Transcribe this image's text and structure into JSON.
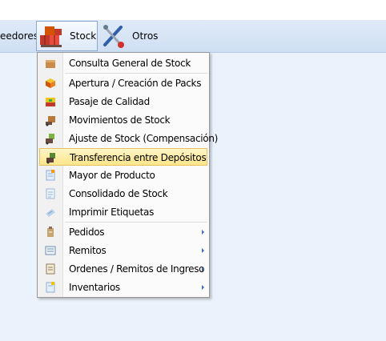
{
  "menubar": {
    "items": [
      {
        "label": "eedores",
        "icon": "none"
      },
      {
        "label": "Stock",
        "icon": "boxes-icon"
      },
      {
        "label": "Otros",
        "icon": "tools-icon"
      }
    ]
  },
  "stock_menu": {
    "items": [
      {
        "label": "Consulta General de Stock",
        "icon": "box-search-icon"
      },
      {
        "label": "Apertura / Creación de Packs",
        "icon": "pack-icon"
      },
      {
        "label": "Pasaje de Calidad",
        "icon": "quality-box-icon"
      },
      {
        "label": "Movimientos de Stock",
        "icon": "movement-icon"
      },
      {
        "label": "Ajuste de Stock (Compensación)",
        "icon": "adjust-icon"
      },
      {
        "label": "Transferencia entre Depósitos",
        "icon": "transfer-icon",
        "highlighted": true
      },
      {
        "label": "Mayor de Producto",
        "icon": "ledger-icon"
      },
      {
        "label": "Consolidado de Stock",
        "icon": "report-icon"
      },
      {
        "label": "Imprimir Etiquetas",
        "icon": "label-print-icon"
      },
      {
        "label": "Pedidos",
        "icon": "order-icon",
        "submenu": true
      },
      {
        "label": "Remitos",
        "icon": "delivery-note-icon",
        "submenu": true
      },
      {
        "label": "Ordenes / Remitos de Ingreso",
        "icon": "intake-icon",
        "submenu": true
      },
      {
        "label": "Inventarios",
        "icon": "inventory-icon",
        "submenu": true
      }
    ]
  },
  "colors": {
    "menubar": "#cfdff3",
    "workspace": "#eaf2fb",
    "highlight": "#ffe68a",
    "submenu_arrow": "#3a6fb8"
  }
}
